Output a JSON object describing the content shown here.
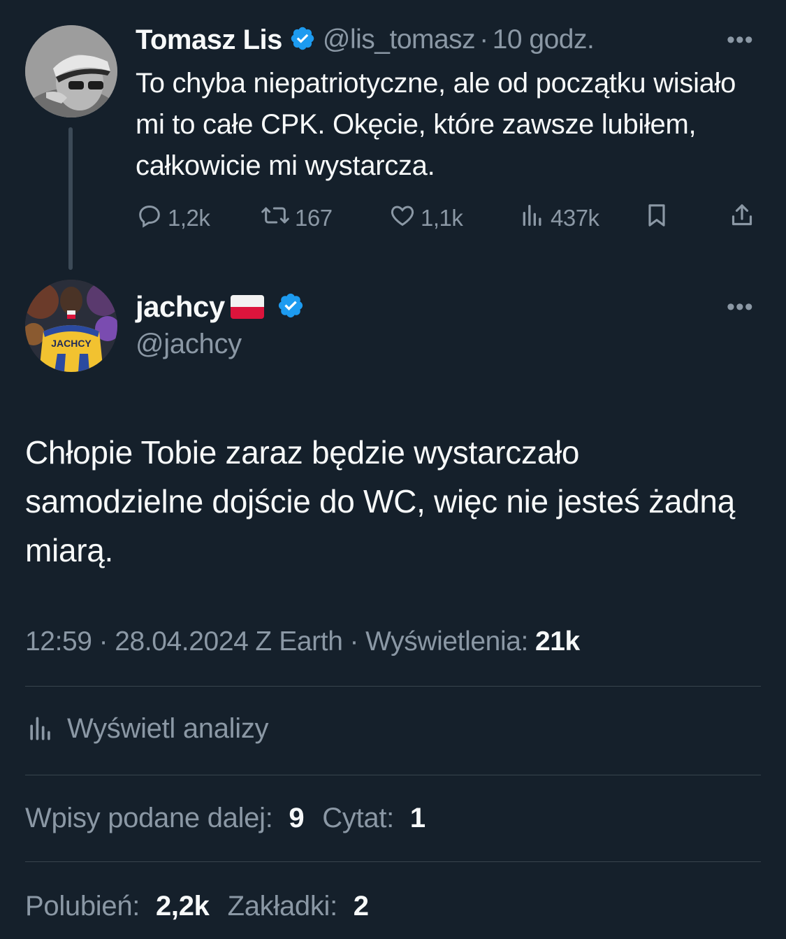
{
  "parent_tweet": {
    "author_name": "Tomasz Lis",
    "handle": "@lis_tomasz",
    "separator": "·",
    "time": "10 godz.",
    "more_icon": "more-horizontal-icon",
    "more_label": "•••",
    "text": "To chyba niepatriotyczne, ale od początku wisiało mi to całe CPK. Okęcie, które zawsze lubiłem, całkowicie mi wystarcza.",
    "actions": {
      "replies": "1,2k",
      "retweets": "167",
      "likes": "1,1k",
      "views": "437k"
    }
  },
  "reply_tweet": {
    "author_name": "jachcy",
    "flag_icon": "poland-flag-icon",
    "handle": "@jachcy",
    "more_label": "•••",
    "avatar_jersey_text": "JACHCY",
    "text": "Chłopie Tobie zaraz będzie wystarczało samodzielne dojście do WC, więc nie jesteś żadną miarą.",
    "meta": {
      "time": "12:59",
      "date": "28.04.2024",
      "location": "Z Earth",
      "views_label": "Wyświetlenia:",
      "views_value": "21k"
    },
    "analytics_label": "Wyświetl analizy",
    "stats": {
      "reposts_label": "Wpisy podane dalej:",
      "reposts_value": "9",
      "quotes_label": "Cytat:",
      "quotes_value": "1",
      "likes_label": "Polubień:",
      "likes_value": "2,2k",
      "bookmarks_label": "Zakładki:",
      "bookmarks_value": "2"
    }
  },
  "colors": {
    "background": "#15202b",
    "text_primary": "#f7f9f9",
    "text_secondary": "#8b98a5",
    "divider": "#38444d",
    "verified_blue": "#1d9bf0",
    "flag_red": "#dc143c"
  }
}
